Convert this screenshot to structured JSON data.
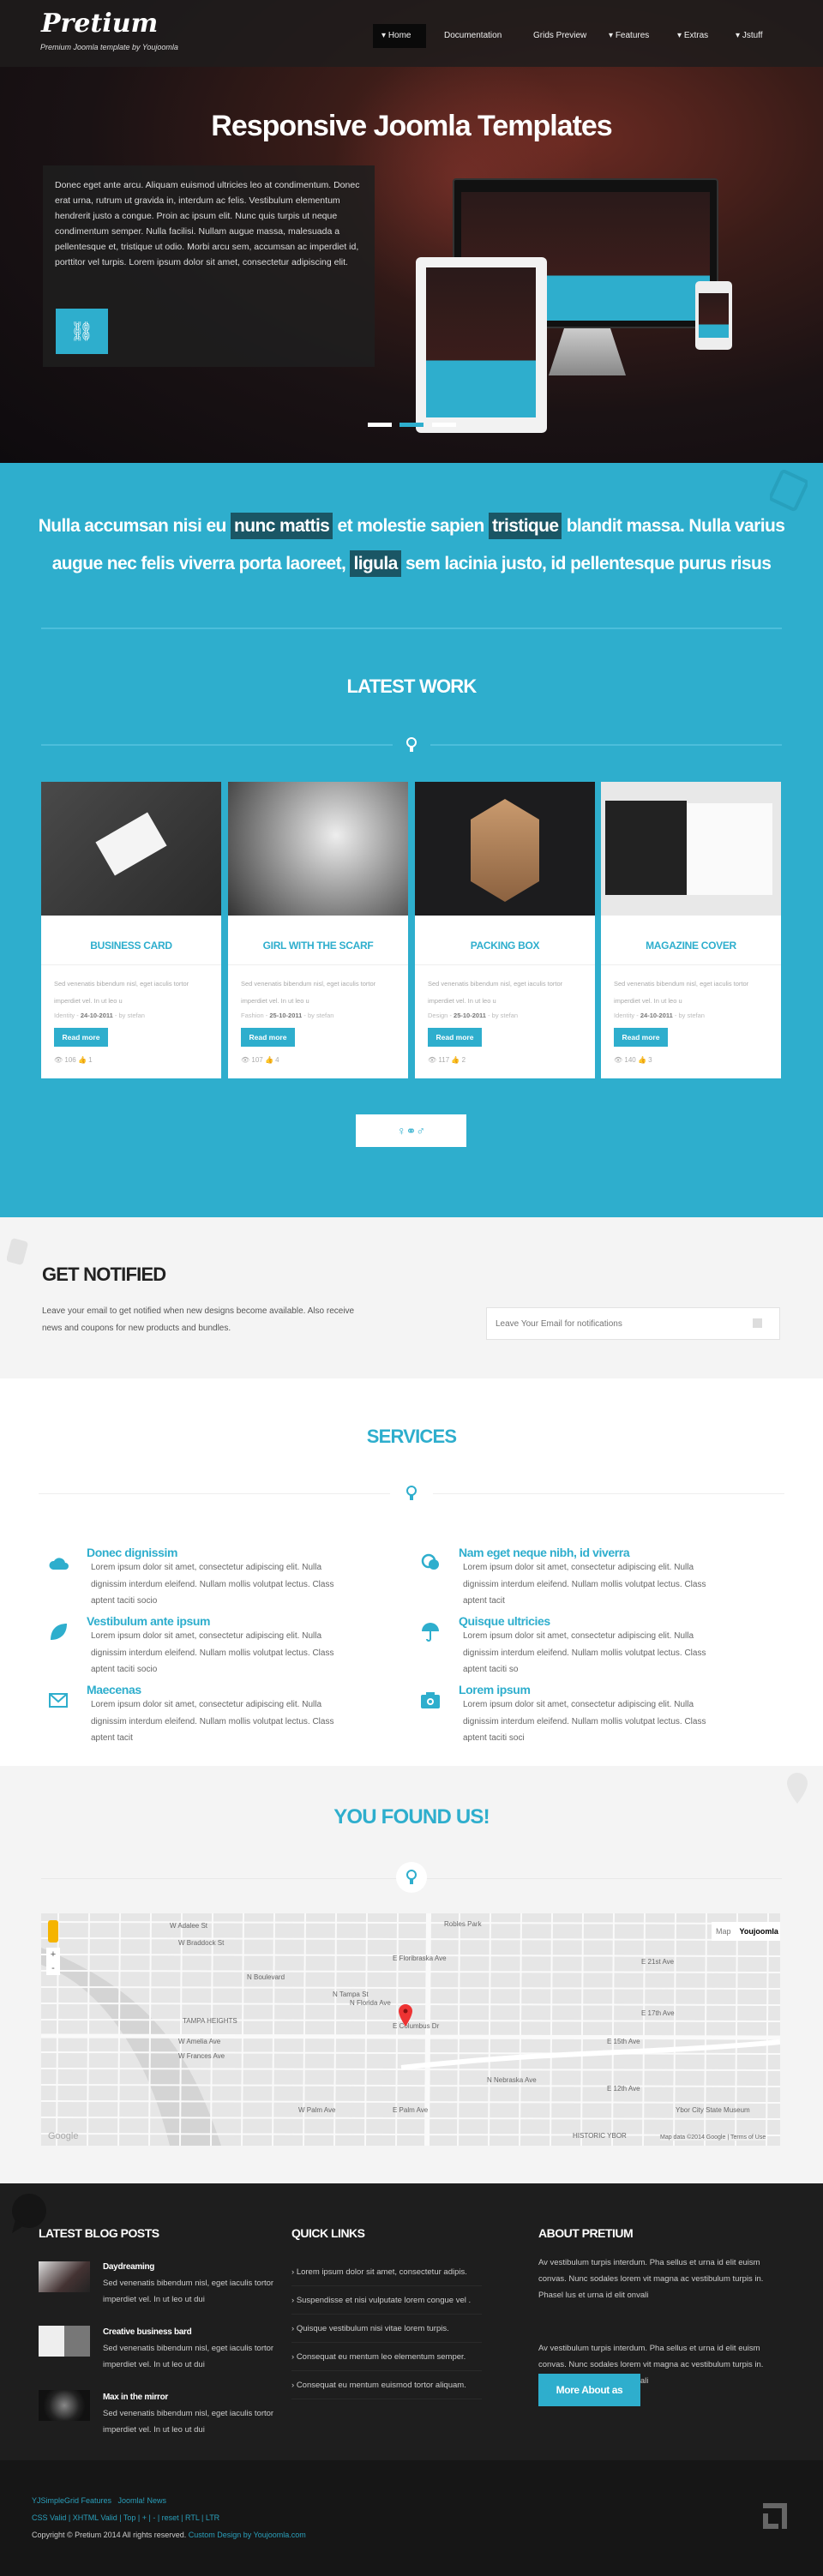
{
  "colors": {
    "accent": "#2eaecd",
    "highlight": "#1a5665",
    "dark": "#1e1e1e"
  },
  "header": {
    "logo": "Pretium",
    "tagline": "Premium Joomla template by Youjoomla",
    "nav": [
      {
        "label": "Home",
        "active": true,
        "dropdown": true
      },
      {
        "label": "Documentation",
        "dropdown": false
      },
      {
        "label": "Grids Preview",
        "dropdown": false
      },
      {
        "label": "Features",
        "dropdown": true
      },
      {
        "label": "Extras",
        "dropdown": true
      },
      {
        "label": "Jstuff",
        "dropdown": true
      }
    ]
  },
  "hero": {
    "title": "Responsive Joomla Templates",
    "text": "Donec eget ante arcu. Aliquam euismod ultricies leo at condimentum. Donec erat urna, rutrum ut gravida in, interdum ac felis. Vestibulum elementum hendrerit justo a congue. Proin ac ipsum elit. Nunc quis turpis ut neque condimentum semper. Nulla facilisi. Nullam augue massa, malesuada a pellentesque et, tristique ut odio. Morbi arcu sem, accumsan ac imperdiet id, porttitor vel turpis. Lorem ipsum dolor sit amet, consectetur adipiscing elit.",
    "button_icon": "link-icon",
    "slides": 3,
    "active_slide": 2
  },
  "intro": {
    "parts": [
      "Nulla accumsan nisi eu ",
      "nunc mattis",
      " et molestie sapien ",
      "tristique",
      " blandit massa. Nulla varius augue nec felis viverra porta laoreet, ",
      "ligula",
      " sem lacinia justo, id pellentesque purus risus"
    ]
  },
  "latest_work": {
    "title": "LATEST WORK",
    "items": [
      {
        "title": "BUSINESS CARD",
        "text": "Sed venenatis bibendum nisl, eget iaculis tortor imperdiet vel. In ut leo u",
        "category": "Identity",
        "date": "24-10-2011",
        "author": "by stefan",
        "read_more": "Read more",
        "views": "106",
        "likes": "1"
      },
      {
        "title": "GIRL WITH THE SCARF",
        "text": "Sed venenatis bibendum nisl, eget iaculis tortor imperdiet vel. In ut leo u",
        "category": "Fashion",
        "date": "25-10-2011",
        "author": "by stefan",
        "read_more": "Read more",
        "views": "107",
        "likes": "4"
      },
      {
        "title": "PACKING BOX",
        "text": "Sed venenatis bibendum nisl, eget iaculis tortor imperdiet vel. In ut leo u",
        "category": "Design",
        "date": "25-10-2011",
        "author": "by stefan",
        "read_more": "Read more",
        "views": "117",
        "likes": "2"
      },
      {
        "title": "MAGAZINE COVER",
        "text": "Sed venenatis bibendum nisl, eget iaculis tortor imperdiet vel. In ut leo u",
        "category": "Identity",
        "date": "24-10-2011",
        "author": "by stefan",
        "read_more": "Read more",
        "views": "140",
        "likes": "3"
      }
    ],
    "more_icon": "people-icon"
  },
  "notify": {
    "title": "GET NOTIFIED",
    "text": "Leave your email to get notified when new designs become available. Also receive news and coupons for new products and bundles.",
    "placeholder": "Leave Your Email for notifications"
  },
  "services": {
    "title": "SERVICES",
    "items": [
      {
        "icon": "cloud-icon",
        "title": "Donec dignissim",
        "text": "Lorem ipsum dolor sit amet, consectetur adipiscing elit. Nulla dignissim interdum eleifend. Nullam mollis volutpat lectus. Class aptent taciti socio"
      },
      {
        "icon": "chat-icon",
        "title": "Nam eget neque nibh, id viverra",
        "text": "Lorem ipsum dolor sit amet, consectetur adipiscing elit. Nulla dignissim interdum eleifend. Nullam mollis volutpat lectus. Class aptent tacit"
      },
      {
        "icon": "leaf-icon",
        "title": "Vestibulum ante ipsum",
        "text": "Lorem ipsum dolor sit amet, consectetur adipiscing elit. Nulla dignissim interdum eleifend. Nullam mollis volutpat lectus. Class aptent taciti socio"
      },
      {
        "icon": "umbrella-icon",
        "title": "Quisque ultricies",
        "text": "Lorem ipsum dolor sit amet, consectetur adipiscing elit. Nulla dignissim interdum eleifend. Nullam mollis volutpat lectus. Class aptent taciti so"
      },
      {
        "icon": "mail-icon",
        "title": "Maecenas",
        "text": "Lorem ipsum dolor sit amet, consectetur adipiscing elit. Nulla dignissim interdum eleifend. Nullam mollis volutpat lectus. Class aptent tacit"
      },
      {
        "icon": "camera-icon",
        "title": "Lorem ipsum",
        "text": "Lorem ipsum dolor sit amet, consectetur adipiscing elit. Nulla dignissim interdum eleifend. Nullam mollis volutpat lectus. Class aptent taciti soci"
      }
    ]
  },
  "found": {
    "title": "YOU FOUND US!",
    "map": {
      "type_buttons": [
        "Map",
        "Youjoomla"
      ],
      "zoom_in": "+",
      "zoom_out": "-",
      "attribution": "Map data ©2014 Google",
      "terms": "Terms of Use",
      "google": "Google",
      "labels": [
        "TAMPA HEIGHTS",
        "E Columbus Dr",
        "N Boulevard",
        "N Florida Ave",
        "N Tampa St",
        "E Floribraska Ave",
        "E 21st Ave",
        "E 17th Ave",
        "E Palm Ave",
        "W Palm Ave",
        "HISTORIC YBOR",
        "Ybor City State Museum",
        "E 12th Ave",
        "N Nebraska Ave",
        "W Amelia Ave",
        "W Frances Ave",
        "Robles Park",
        "W Adalee St",
        "W Braddock St",
        "E 15th Ave"
      ]
    }
  },
  "footer": {
    "blog": {
      "title": "LATEST BLOG POSTS",
      "posts": [
        {
          "title": "Daydreaming",
          "text": "Sed venenatis bibendum nisl, eget iaculis tortor imperdiet vel. In ut leo ut dui"
        },
        {
          "title": "Creative business bard",
          "text": "Sed venenatis bibendum nisl, eget iaculis tortor imperdiet vel. In ut leo ut dui"
        },
        {
          "title": "Max in the mirror",
          "text": "Sed venenatis bibendum nisl, eget iaculis tortor imperdiet vel. In ut leo ut dui"
        }
      ]
    },
    "quick": {
      "title": "QUICK LINKS",
      "links": [
        "Lorem ipsum dolor sit amet, consectetur adipis.",
        "Suspendisse et nisi vulputate lorem congue vel .",
        "Quisque vestibulum nisi vitae lorem turpis.",
        "Consequat eu mentum leo elementum semper.",
        "Consequat eu mentum euismod tortor aliquam."
      ]
    },
    "about": {
      "title": "ABOUT PRETIUM",
      "p1": "Av vestibulum turpis interdum. Pha sellus et urna id elit euism convas. Nunc sodales lorem vit magna ac vestibulum turpis in. Phasel lus et urna id elit onvali",
      "p2": "Av vestibulum turpis interdum. Pha sellus et urna id elit euism convas. Nunc sodales lorem vit magna ac vestibulum turpis in. Phasel lus et urna id elit onvali",
      "button": "More About as"
    }
  },
  "bottom": {
    "links1": "YJSimpleGrid Features   Joomla! News",
    "links2": "CSS Valid | XHTML Valid | Top | + | - | reset | RTL | LTR",
    "copyright": "Copyright © Pretium 2014 All rights reserved. ",
    "credit": "Custom Design by Youjoomla.com"
  }
}
